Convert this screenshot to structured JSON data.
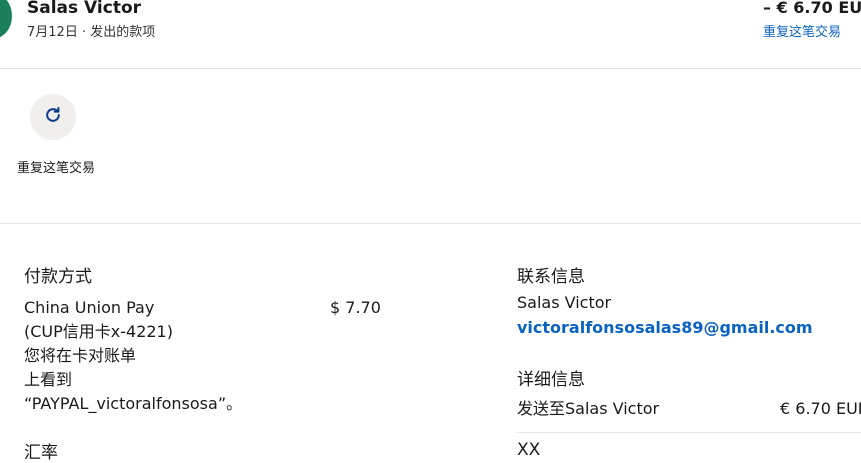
{
  "header": {
    "name": "Salas Victor",
    "subtitle": "7月12日 · 发出的款项",
    "amount": "– € 6.70 EUR",
    "repeat_link": "重复这笔交易"
  },
  "actions": {
    "repeat_label": "重复这笔交易"
  },
  "payment": {
    "title": "付款方式",
    "method_line1": "China Union Pay",
    "method_line2": "(CUP信用卡x-4221)",
    "note_line1": "您将在卡对账单",
    "note_line2": "上看到",
    "note_line3": "“PAYPAL_victoralfonsosa”。",
    "amount": "$ 7.70",
    "exchange_title": "汇率"
  },
  "contact": {
    "title": "联系信息",
    "name": "Salas Victor",
    "email": "victoralfonsosalas89@gmail.com"
  },
  "details": {
    "title": "详细信息",
    "sent_to": "发送至Salas Victor",
    "amount": "€ 6.70 EUR",
    "next_row": "XX"
  }
}
